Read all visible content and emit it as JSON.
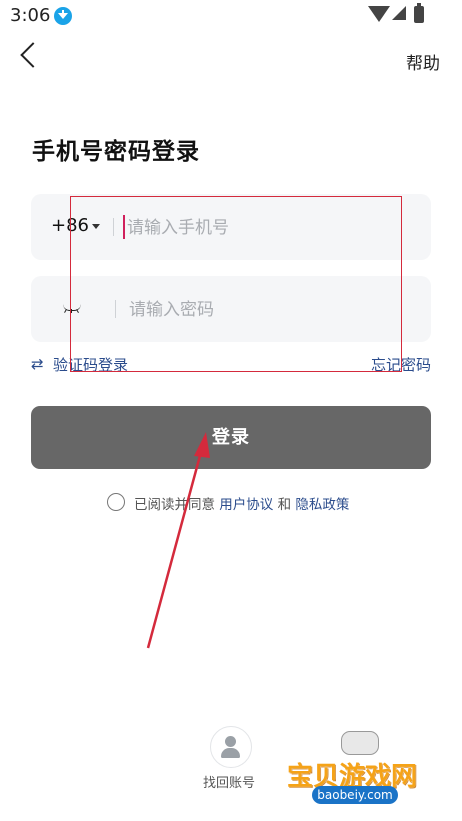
{
  "status": {
    "time": "3:06"
  },
  "header": {
    "help": "帮助"
  },
  "title": "手机号密码登录",
  "phone": {
    "country_code": "+86",
    "placeholder": "请输入手机号"
  },
  "password": {
    "placeholder": "请输入密码"
  },
  "links": {
    "sms_login": "验证码登录",
    "forgot": "忘记密码"
  },
  "login_button": "登录",
  "agreement": {
    "prefix": "已阅读并同意",
    "terms": "用户协议",
    "and": "和",
    "privacy": "隐私政策"
  },
  "recover": {
    "label": "找回账号"
  },
  "watermark": {
    "text": "宝贝游戏网",
    "sub": "baobeiy.com"
  },
  "colors": {
    "link": "#2b4c8c",
    "button": "#676767",
    "annotation": "#d42a3c",
    "cursor": "#d0205c"
  }
}
